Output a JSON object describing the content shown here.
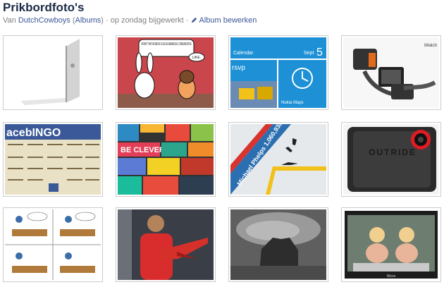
{
  "album": {
    "title": "Prikbordfoto's",
    "meta": {
      "by_prefix": "Van",
      "owner": "DutchCowboys",
      "albums_open": "(",
      "albums_link": "Albums",
      "albums_close": ")",
      "separator": "·",
      "updated": "op zondag bijgewerkt",
      "edit_link": "Album bewerken"
    }
  },
  "photos": [
    {
      "desc": "white-laptop-side"
    },
    {
      "desc": "comic-bunny",
      "speech1": "I WORRY THAT FACEBOOK IS KILLING MEANINGFUL COMMUNICATION.",
      "speech2": "LIKE."
    },
    {
      "desc": "windows-phone-tiles",
      "tile_calendar": "Calendar",
      "tile_sept": "Sept",
      "tile_day": "5",
      "tile_rsvp": "rsvp",
      "tile_maps": "Nokia Maps"
    },
    {
      "desc": "watch-concept",
      "label": "iWatch"
    },
    {
      "desc": "facebook-bingo",
      "heading": "acebINGO"
    },
    {
      "desc": "be-clever-posters",
      "banner": "BE CLEVER"
    },
    {
      "desc": "michael-phelps-ad",
      "line1": "Michael Phelps 1,060,938",
      "line2": "likes"
    },
    {
      "desc": "outride-camera",
      "label": "OUTRIDE"
    },
    {
      "desc": "office-comic"
    },
    {
      "desc": "man-red-plane"
    },
    {
      "desc": "mars-rover-shadow"
    },
    {
      "desc": "two-women-monitor",
      "label": "Nikon"
    }
  ]
}
